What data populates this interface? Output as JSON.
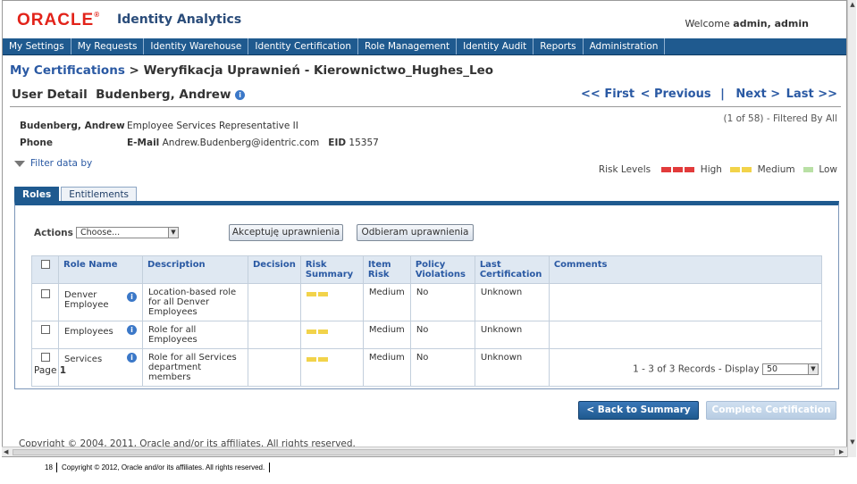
{
  "header": {
    "logo_text": "ORACLE",
    "product": "Identity Analytics",
    "welcome_prefix": "Welcome ",
    "welcome_user": "admin, admin"
  },
  "nav": [
    "My Settings",
    "My Requests",
    "Identity Warehouse",
    "Identity Certification",
    "Role Management",
    "Identity Audit",
    "Reports",
    "Administration"
  ],
  "breadcrumb": {
    "root": "My Certifications",
    "separator": " > ",
    "current": "Weryfikacja Uprawnień - Kierownictwo_Hughes_Leo"
  },
  "user_detail": {
    "label": "User Detail",
    "name": "Budenberg, Andrew",
    "pager": {
      "first": "<< First",
      "previous": "< Previous",
      "divider": "|",
      "next": "Next >",
      "last": "Last >>"
    },
    "record_count": "(1 of 58) - Filtered By All",
    "title": "Employee Services Representative II",
    "phone_label": "Phone",
    "email_label": "E-Mail",
    "email": "Andrew.Budenberg@identric.com",
    "eid_label": "EID",
    "eid": "15357"
  },
  "filter_label": "Filter data by",
  "risk_levels": {
    "label": "Risk Levels",
    "high": "High",
    "medium": "Medium",
    "low": "Low",
    "high_color": "#e23b3b",
    "medium_color": "#f2d34a",
    "low_color": "#b9e0a5"
  },
  "tabs": [
    {
      "label": "Roles",
      "active": true
    },
    {
      "label": "Entitlements",
      "active": false
    }
  ],
  "actions": {
    "label": "Actions",
    "select_value": "Choose...",
    "accept_button": "Akceptuję uprawnienia",
    "reject_button": "Odbieram uprawnienia"
  },
  "table": {
    "headers": {
      "role_name": "Role Name",
      "description": "Description",
      "decision": "Decision",
      "risk_summary": "Risk Summary",
      "item_risk": "Item Risk",
      "policy_violations": "Policy Violations",
      "last_certification": "Last Certification",
      "comments": "Comments"
    },
    "rows": [
      {
        "name": "Denver Employee",
        "description": "Location-based role for all Denver Employees",
        "decision": "",
        "risk_summary": "Medium",
        "item_risk": "Medium",
        "policy_violations": "No",
        "last_certification": "Unknown",
        "comments": ""
      },
      {
        "name": "Employees",
        "description": "Role for all Employees",
        "decision": "",
        "risk_summary": "Medium",
        "item_risk": "Medium",
        "policy_violations": "No",
        "last_certification": "Unknown",
        "comments": ""
      },
      {
        "name": "Services",
        "description": "Role for all Services department members",
        "decision": "",
        "risk_summary": "Medium",
        "item_risk": "Medium",
        "policy_violations": "No",
        "last_certification": "Unknown",
        "comments": ""
      }
    ]
  },
  "paging": {
    "page_label": "Page",
    "page_number": "1",
    "records_text": "1 - 3 of 3 Records - Display",
    "display_value": "50"
  },
  "buttons": {
    "back": "< Back to Summary",
    "complete": "Complete Certification"
  },
  "copyright": "Copyright © 2004, 2011, Oracle and/or its affiliates. All rights reserved.",
  "slide_footer": {
    "number": "18",
    "text": "Copyright © 2012, Oracle and/or its affiliates. All rights reserved."
  }
}
